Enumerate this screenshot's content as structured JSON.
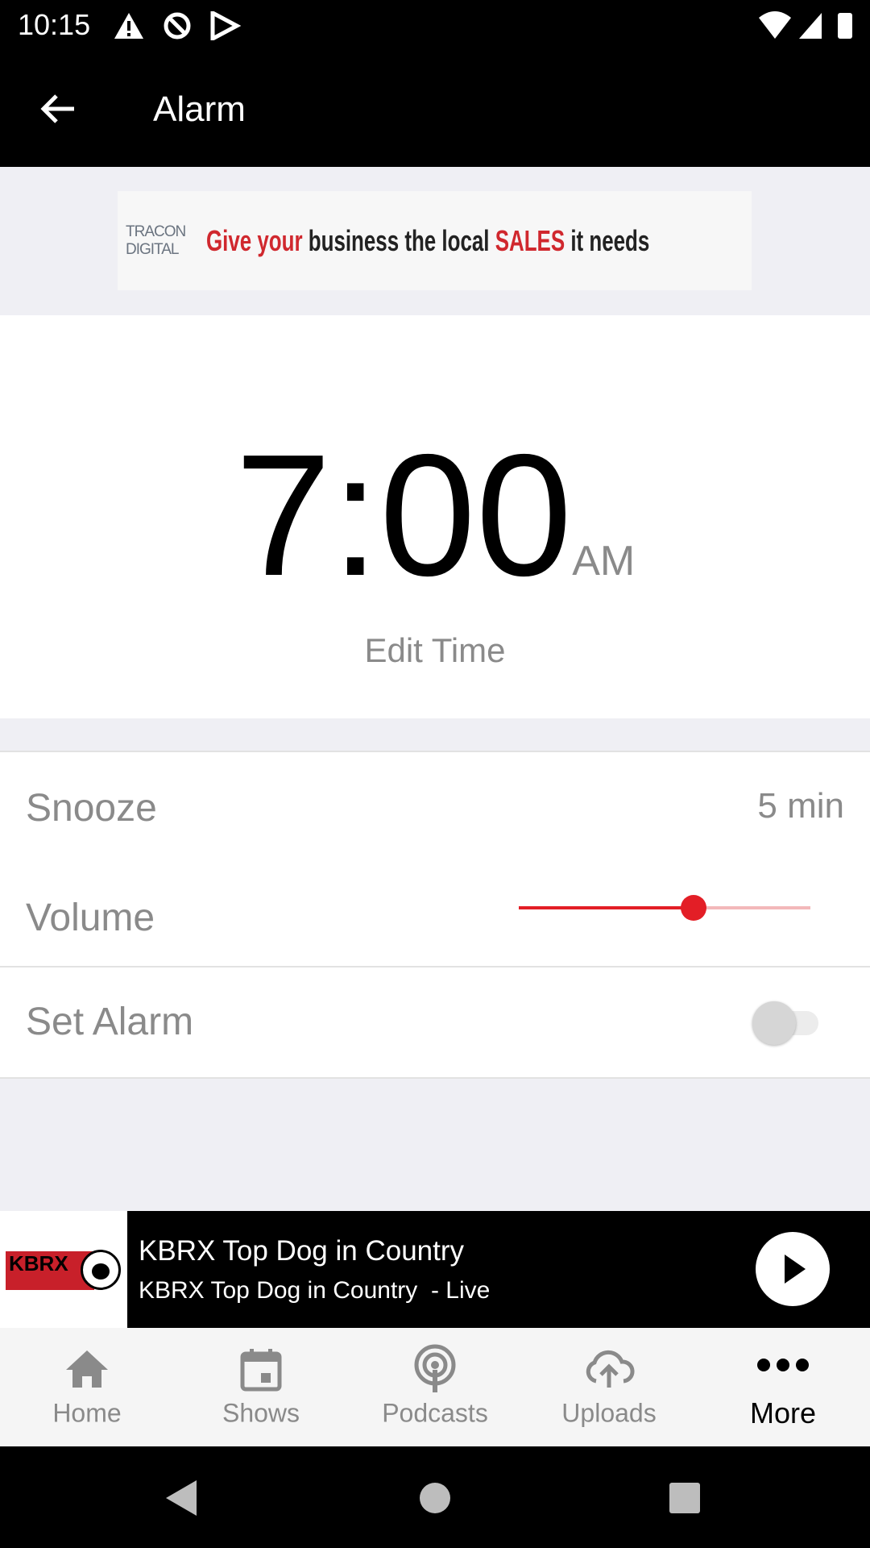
{
  "status_bar": {
    "time": "10:15",
    "icons": [
      "warning-icon",
      "data-saver-icon",
      "play-store-icon",
      "wifi-icon",
      "signal-icon",
      "battery-icon"
    ]
  },
  "app_bar": {
    "title": "Alarm",
    "back_icon": "arrow-left-icon"
  },
  "ad": {
    "brand": "TRACON DIGITAL",
    "text_red1": "Give your",
    "text_black1": "business the local",
    "text_red2": "SALES",
    "text_black2": "it needs"
  },
  "alarm": {
    "time": "7:00",
    "ampm": "AM",
    "edit_label": "Edit Time"
  },
  "settings": {
    "snooze": {
      "label": "Snooze",
      "value": "5 min"
    },
    "volume": {
      "label": "Volume",
      "level": 0.6
    },
    "set_alarm": {
      "label": "Set Alarm",
      "enabled": false
    }
  },
  "player": {
    "logo": "KBRX TOP DOG IN COUNTRY 102.9 FM | KBRX.COM",
    "title": "KBRX Top Dog in Country",
    "subtitle": "KBRX Top Dog in Country  - Live",
    "play_icon": "play-icon"
  },
  "bottom_nav": {
    "items": [
      {
        "label": "Home",
        "icon": "home-icon"
      },
      {
        "label": "Shows",
        "icon": "calendar-icon"
      },
      {
        "label": "Podcasts",
        "icon": "podcast-icon"
      },
      {
        "label": "Uploads",
        "icon": "cloud-upload-icon"
      },
      {
        "label": "More",
        "icon": "more-dots-icon",
        "active": true
      }
    ]
  },
  "colors": {
    "accent": "#e31e26",
    "inactive": "#8a8a8a"
  }
}
